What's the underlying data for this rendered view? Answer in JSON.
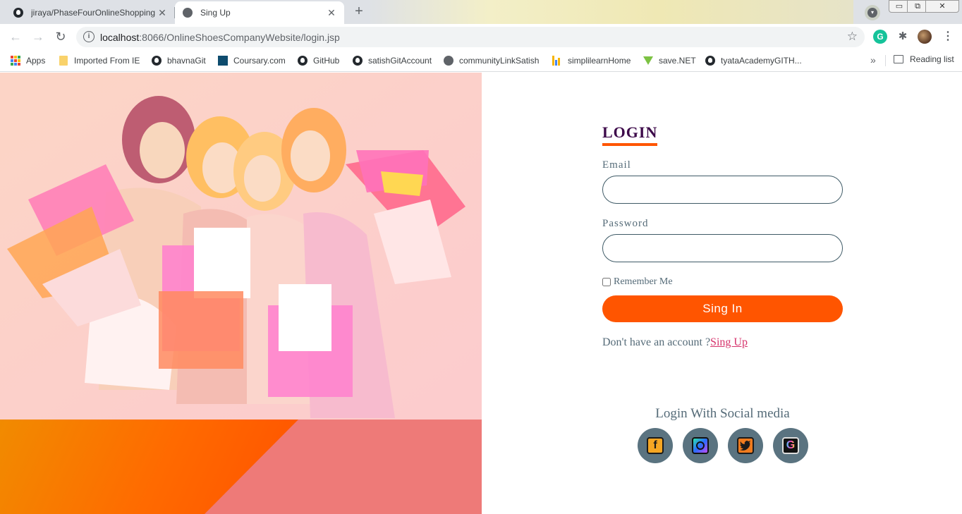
{
  "browser": {
    "tabs": [
      {
        "title": "jiraya/PhaseFourOnlineShopping",
        "active": false,
        "icon": "github-icon"
      },
      {
        "title": "Sing Up",
        "active": true,
        "icon": "globe-icon"
      }
    ],
    "new_tab_label": "+",
    "address": {
      "host": "localhost",
      "path": ":8066/OnlineShoesCompanyWebsite/login.jsp"
    },
    "extensions": [
      "grammarly-icon",
      "puzzle-icon",
      "profile-avatar",
      "menu-icon"
    ],
    "window_controls": {
      "minimize": "▭",
      "maximize": "⧉",
      "close": "✕"
    }
  },
  "bookmarks": {
    "items": [
      {
        "label": "Apps",
        "icon": "apps-grid-icon"
      },
      {
        "label": "Imported From IE",
        "icon": "folder-icon"
      },
      {
        "label": "bhavnaGit",
        "icon": "github-icon"
      },
      {
        "label": "Coursary.com",
        "icon": "coursary-icon"
      },
      {
        "label": "GitHub",
        "icon": "github-icon"
      },
      {
        "label": "satishGitAccount",
        "icon": "github-icon"
      },
      {
        "label": "communityLinkSatish",
        "icon": "globe-icon"
      },
      {
        "label": "simplilearnHome",
        "icon": "bars-icon"
      },
      {
        "label": "save.NET",
        "icon": "download-arrow-icon"
      },
      {
        "label": "tyataAcademyGITH...",
        "icon": "github-icon"
      }
    ],
    "more": "»",
    "reading_list": "Reading list"
  },
  "login": {
    "title": "LOGIN",
    "email_label": "Email",
    "email_value": "",
    "password_label": "Password",
    "password_value": "",
    "remember_label": "Remember Me",
    "remember_checked": false,
    "submit_label": "Sing In",
    "no_account_text": "Don't have an account ?",
    "signup_link": "Sing Up"
  },
  "social": {
    "title": "Login With Social media",
    "buttons": [
      {
        "name": "facebook",
        "glyph": "f"
      },
      {
        "name": "instagram",
        "glyph": ""
      },
      {
        "name": "twitter",
        "glyph": ""
      },
      {
        "name": "google",
        "glyph": "G"
      }
    ]
  },
  "colors": {
    "accent": "#ff5500",
    "title": "#3d0a4a",
    "label": "#556b78",
    "link": "#d6336c",
    "social_bg": "#5a7380",
    "deco_pink": "#ee7a78"
  }
}
